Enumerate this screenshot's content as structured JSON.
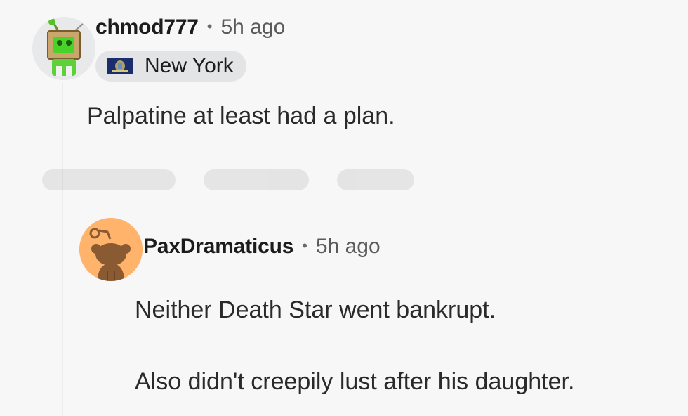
{
  "comments": [
    {
      "username": "chmod777",
      "separator": "•",
      "time": "5h ago",
      "flair": {
        "text": "New York",
        "flag_icon": "new-york-flag-icon"
      },
      "body": [
        "Palpatine at least had a plan."
      ],
      "avatar_icon": "robot-avatar-icon"
    },
    {
      "username": "PaxDramaticus",
      "separator": "•",
      "time": "5h ago",
      "body": [
        "Neither Death Star went bankrupt.",
        "Also didn't creepily lust after his daughter."
      ],
      "avatar_icon": "snoo-avatar-icon"
    }
  ],
  "colors": {
    "background": "#f7f7f8",
    "flair_bg": "#e3e4e6",
    "avatar2_bg": "#ffb36b",
    "snoo_body": "#8a5a32"
  }
}
